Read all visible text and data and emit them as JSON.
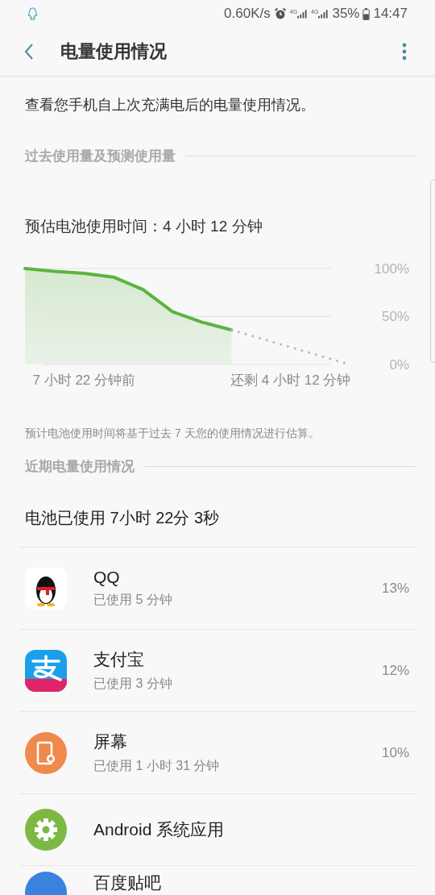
{
  "status_bar": {
    "speed": "0.60K/s",
    "network_labels": [
      "4G",
      "4G"
    ],
    "battery": "35%",
    "time": "14:47"
  },
  "header": {
    "title": "电量使用情况"
  },
  "description": "查看您手机自上次充满电后的电量使用情况。",
  "past_section": {
    "title": "过去使用量及预测使用量"
  },
  "estimate": "预估电池使用时间：4 小时 12 分钟",
  "chart": {
    "chart_data": {
      "type": "line",
      "categories": [
        null,
        null,
        "7 小时 22 分钟前",
        null,
        null,
        null,
        null,
        null,
        null,
        "还剩 4 小时 12 分钟",
        null,
        null
      ],
      "ylim": [
        0,
        100
      ],
      "yticks": [
        {
          "value": 100,
          "label": "100%"
        },
        {
          "value": 50,
          "label": "50%"
        },
        {
          "value": 0,
          "label": "0%"
        }
      ],
      "series": [
        {
          "color": "#5cb441",
          "line_style": "solid",
          "values": [
            100,
            97,
            95,
            91,
            78,
            55,
            44,
            36,
            null,
            null,
            null,
            null
          ]
        },
        {
          "color": "#b9b9c0",
          "line_style": "dotted",
          "values": [
            null,
            null,
            null,
            null,
            null,
            null,
            null,
            36,
            27,
            18,
            9,
            0
          ]
        }
      ]
    }
  },
  "note": "预计电池使用时间将基于过去 7 天您的使用情况进行估算。",
  "recent_section": {
    "title": "近期电量使用情况"
  },
  "total_used": "电池已使用 7小时 22分 3秒",
  "apps": [
    {
      "kind": "qq",
      "name": "QQ",
      "usage": "已使用 5 分钟",
      "percent": "13%"
    },
    {
      "kind": "pay",
      "name": "支付宝",
      "usage": "已使用 3 分钟",
      "percent": "12%"
    },
    {
      "kind": "screen",
      "name": "屏幕",
      "usage": "已使用 1 小时 31 分钟",
      "percent": "10%"
    },
    {
      "kind": "system",
      "name": "Android 系统应用"
    },
    {
      "kind": "forum",
      "name": "百度贴吧"
    }
  ]
}
